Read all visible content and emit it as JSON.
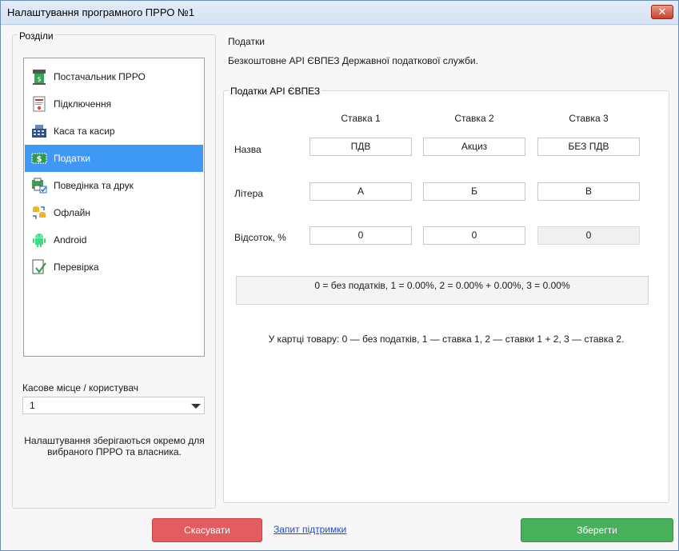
{
  "window": {
    "title": "Налаштування програмного ПРРО №1",
    "close_label": "✕"
  },
  "sidebar": {
    "legend": "Розділи",
    "items": [
      {
        "label": "Постачальник ПРРО",
        "icon": "cash-register-icon",
        "selected": false
      },
      {
        "label": "Підключення",
        "icon": "certificate-icon",
        "selected": false
      },
      {
        "label": "Каса та касир",
        "icon": "pos-terminal-icon",
        "selected": false
      },
      {
        "label": "Податки",
        "icon": "tax-money-icon",
        "selected": true
      },
      {
        "label": "Поведінка та друк",
        "icon": "printer-check-icon",
        "selected": false
      },
      {
        "label": "Офлайн",
        "icon": "offline-sync-icon",
        "selected": false
      },
      {
        "label": "Android",
        "icon": "android-icon",
        "selected": false
      },
      {
        "label": "Перевірка",
        "icon": "verify-check-icon",
        "selected": false
      }
    ],
    "kasa_label": "Касове місце / користувач",
    "kasa_value": "1",
    "note": "Налаштування зберігаються окремо для вибраного ПРРО та власника."
  },
  "main": {
    "title": "Податки",
    "description": "Безкоштовне API ЄВПЕЗ Державної податкової служби.",
    "group_legend": "Податки API ЄВПЕЗ",
    "columns": [
      "Ставка 1",
      "Ставка 2",
      "Ставка 3"
    ],
    "rows": {
      "name": {
        "label": "Назва",
        "values": [
          "ПДВ",
          "Акциз",
          "БЕЗ ПДВ"
        ]
      },
      "letter": {
        "label": "Літера",
        "values": [
          "А",
          "Б",
          "В"
        ]
      },
      "percent": {
        "label": "Відсоток, %",
        "values": [
          "0",
          "0",
          "0"
        ]
      }
    },
    "summary": "0 = без податків,   1 = 0.00%,  2 = 0.00% + 0.00%,   3 = 0.00%",
    "hint": "У картці товару: 0 — без податків, 1 — ставка 1, 2 — ставки 1 + 2, 3 — ставка 2."
  },
  "footer": {
    "cancel_label": "Скасувати",
    "support_label": "Запит підтримки",
    "save_label": "Зберегти"
  },
  "colors": {
    "selected": "#3d99f5",
    "cancel": "#e35c60",
    "save": "#47b05a",
    "link": "#1a4bd6"
  }
}
